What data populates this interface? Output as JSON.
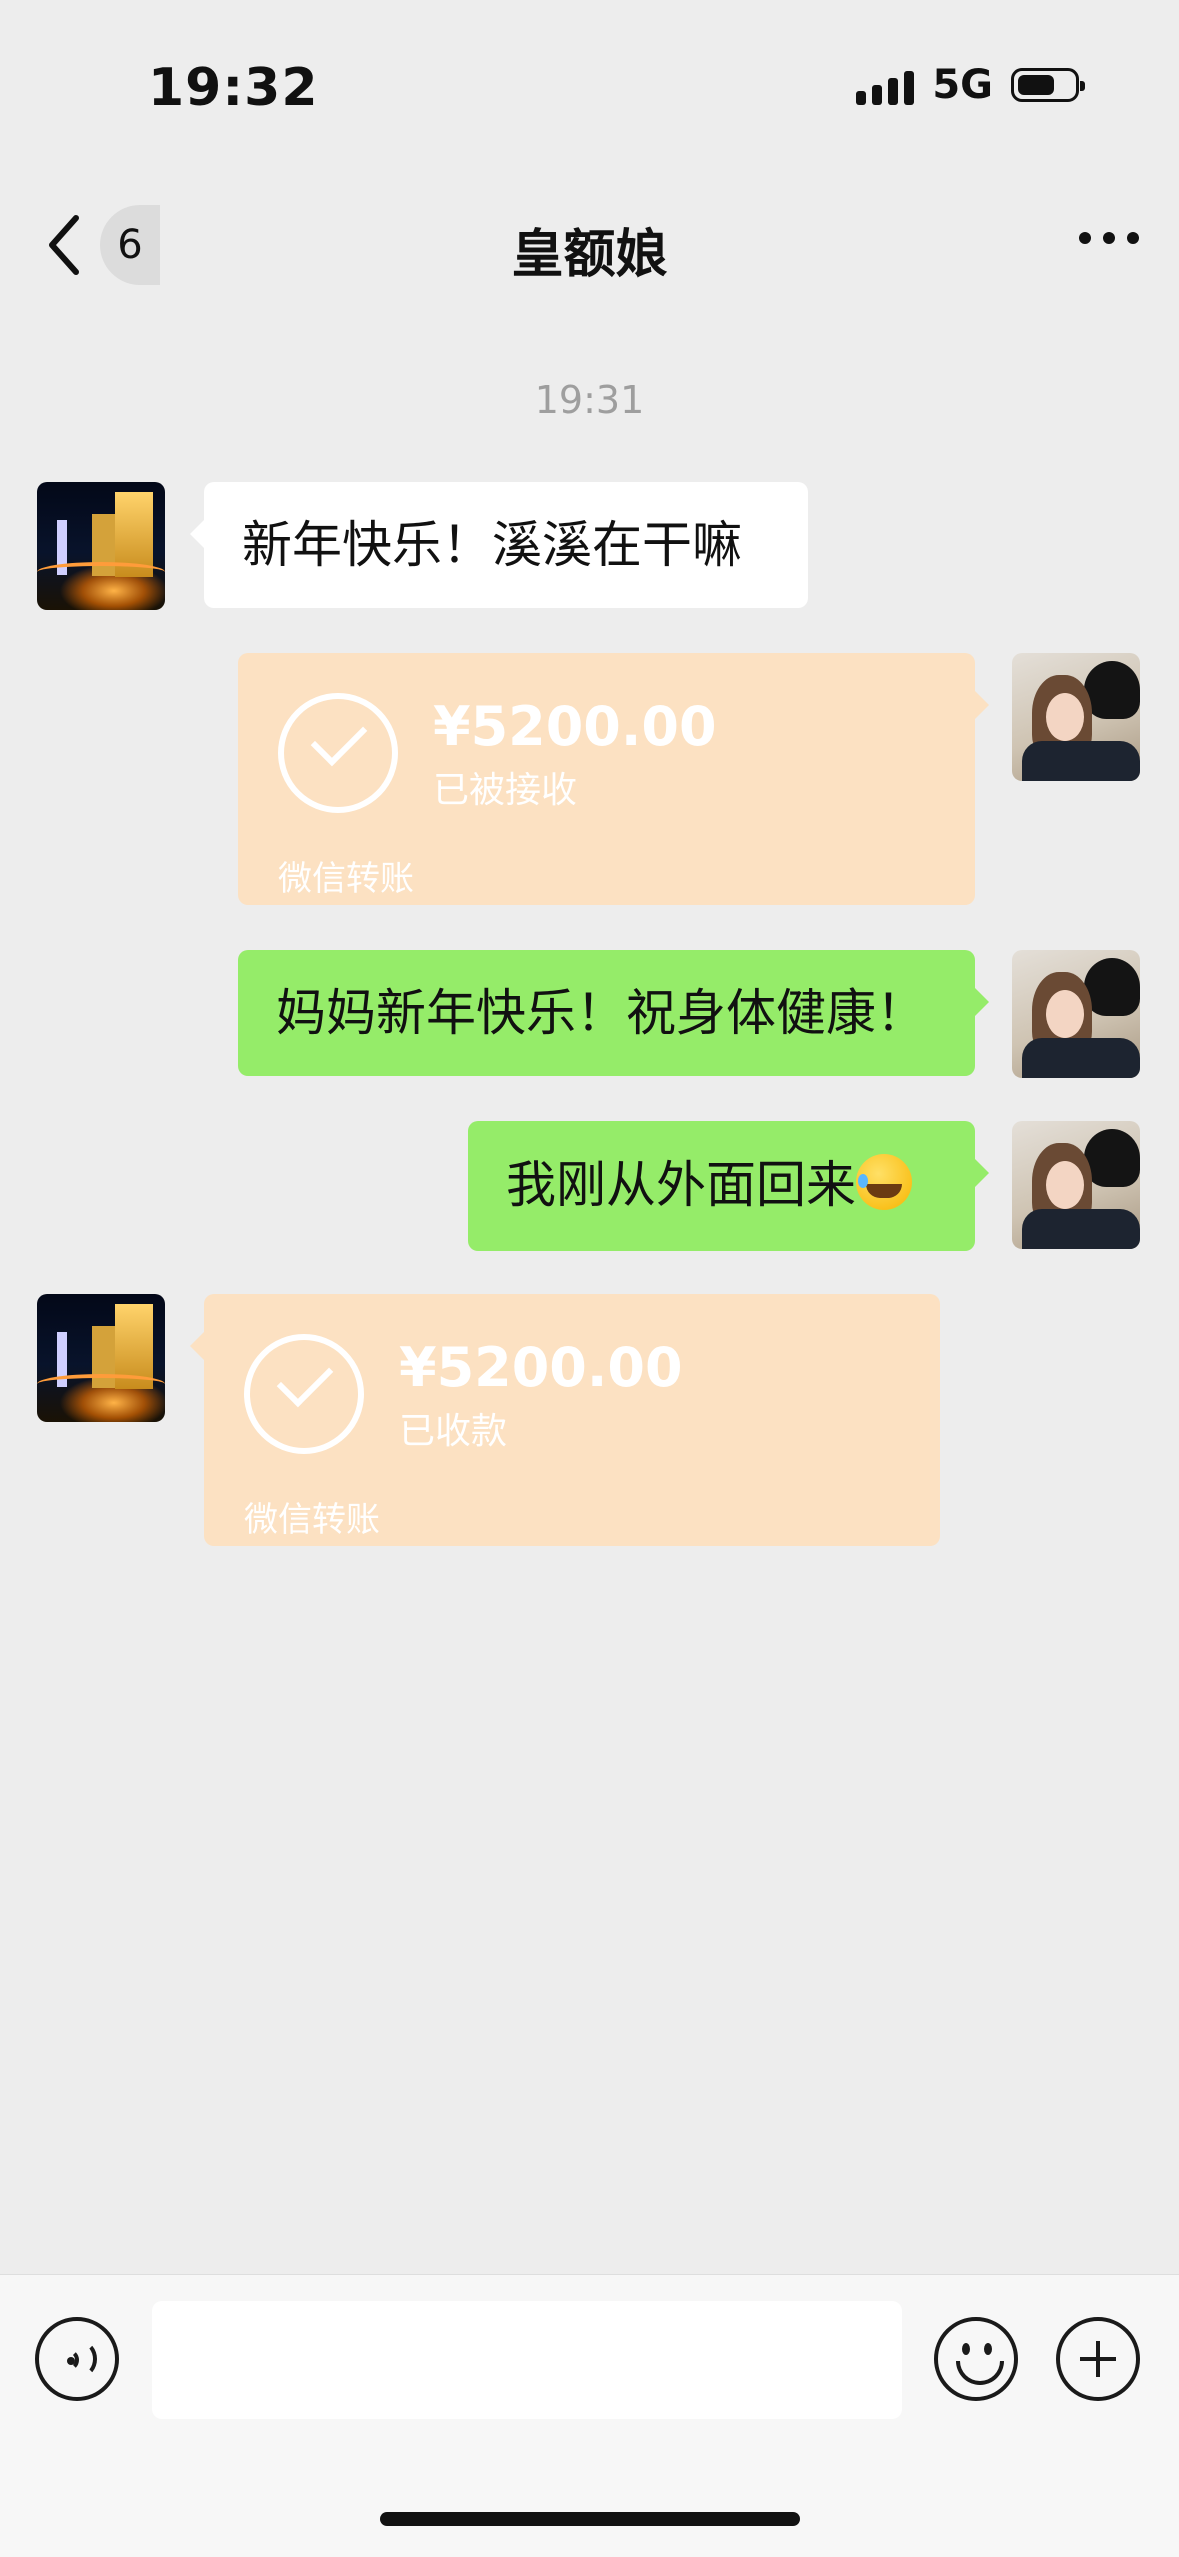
{
  "status_bar": {
    "time": "19:32",
    "network": "5G"
  },
  "nav": {
    "unread_count": "6",
    "title": "皇额娘"
  },
  "chat": {
    "timestamp": "19:31",
    "messages": [
      {
        "type": "text",
        "side": "left",
        "text": "新年快乐！溪溪在干嘛"
      },
      {
        "type": "transfer",
        "side": "right",
        "amount": "¥5200.00",
        "status": "已被接收",
        "brand": "微信转账"
      },
      {
        "type": "text",
        "side": "right",
        "text": "妈妈新年快乐！祝身体健康！"
      },
      {
        "type": "text",
        "side": "right",
        "text": "我刚从外面回来"
      },
      {
        "type": "transfer",
        "side": "left",
        "amount": "¥5200.00",
        "status": "已收款",
        "brand": "微信转账"
      }
    ]
  },
  "input": {
    "value": "",
    "placeholder": ""
  },
  "colors": {
    "background": "#ededed",
    "bubble_green": "#95ec69",
    "bubble_white": "#ffffff",
    "transfer_received": "#fce1c2"
  }
}
